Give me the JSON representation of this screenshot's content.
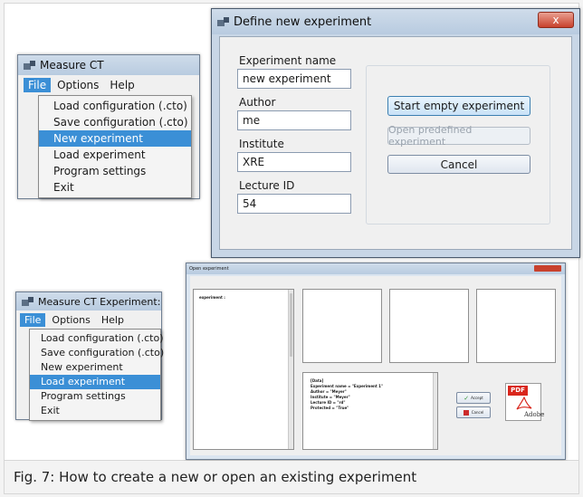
{
  "caption": "Fig. 7: How to create a new or open an existing experiment",
  "menu1": {
    "title": "Measure CT",
    "menubar": [
      "File",
      "Options",
      "Help"
    ],
    "items": [
      "Load configuration (.cto)",
      "Save configuration (.cto)",
      "New experiment",
      "Load experiment",
      "Program settings",
      "Exit"
    ],
    "highlighted": "New experiment"
  },
  "dialog": {
    "title": "Define new experiment",
    "close_label": "x",
    "fields": [
      {
        "label": "Experiment name",
        "value": "new experiment"
      },
      {
        "label": "Author",
        "value": "me"
      },
      {
        "label": "Institute",
        "value": "XRE"
      },
      {
        "label": "Lecture ID",
        "value": "54"
      }
    ],
    "buttons": {
      "start": "Start empty experiment",
      "open": "Open predefined experiment",
      "cancel": "Cancel"
    }
  },
  "menu2": {
    "title": "Measure CT Experiment:",
    "menubar": [
      "File",
      "Options",
      "Help"
    ],
    "items": [
      "Load configuration (.cto)",
      "Save configuration (.cto)",
      "New experiment",
      "Load experiment",
      "Program settings",
      "Exit"
    ],
    "highlighted": "Load experiment"
  },
  "open_window": {
    "title": "Open experiment",
    "list_header": "experiment :",
    "info_lines": [
      "[Data]",
      "Experiment name = \"Experiment 1\"",
      "Author = \"Meyer\"",
      "Institute = \"Meyer\"",
      "Lecture ID = \"rd\"",
      "Protected = \"True\""
    ],
    "accept": "Accept",
    "cancel": "Cancel",
    "pdf_label": "PDF",
    "adobe_label": "Adobe"
  },
  "colors": {
    "highlight": "#3b8fd6",
    "close": "#c8412d",
    "accept": "#3a9a3a",
    "cancel_icon": "#cc2b2b",
    "pdf": "#d9261c"
  }
}
